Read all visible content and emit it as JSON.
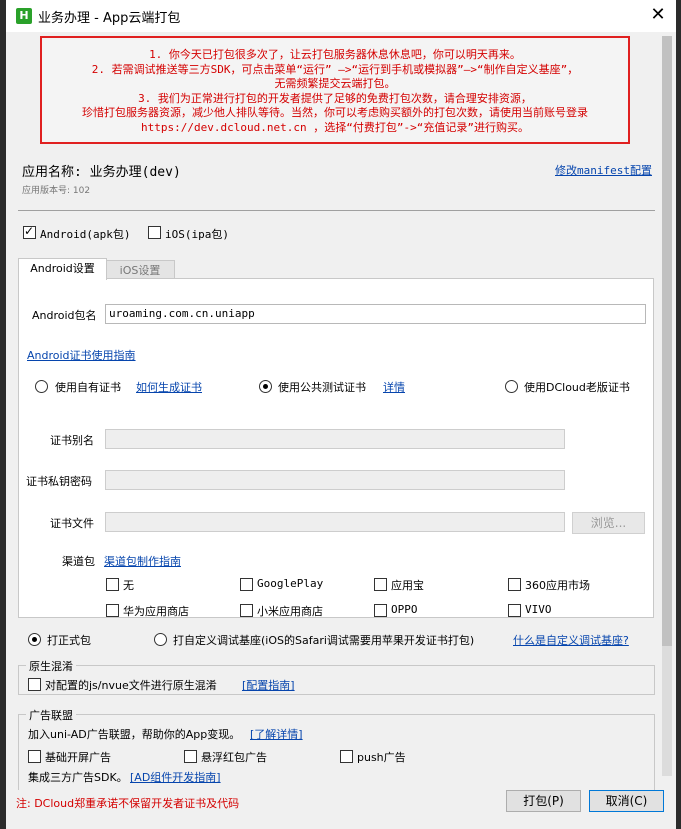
{
  "window": {
    "title": "业务办理 - App云端打包",
    "icon_letter": "H"
  },
  "notice": {
    "lines": [
      "1. 你今天已打包很多次了，让云打包服务器休息休息吧，你可以明天再来。",
      "2. 若需调试推送等三方SDK，可点击菜单“运行” —>“运行到手机或模拟器”—>“制作自定义基座”，",
      "无需频繁提交云端打包。",
      "3. 我们为正常进行打包的开发者提供了足够的免费打包次数，请合理安排资源，",
      "珍惜打包服务器资源，减少他人排队等待。当然，你可以考虑购买额外的打包次数，请使用当前账号登录",
      "https://dev.dcloud.net.cn ，选择“付费打包”->“充值记录”进行购买。"
    ]
  },
  "app": {
    "name_label": "应用名称: 业务办理(dev)",
    "version_label": "应用版本号: 102",
    "manifest_link": "修改manifest配置"
  },
  "platforms": {
    "android_label": "Android(apk包)",
    "ios_label": "iOS(ipa包)"
  },
  "tabs": {
    "android": "Android设置",
    "ios": "iOS设置"
  },
  "android": {
    "package_label": "Android包名",
    "package_value": "uroaming.com.cn.uniapp",
    "cert_guide_link": "Android证书使用指南",
    "cert_own_label": "使用自有证书",
    "cert_own_link": "如何生成证书",
    "cert_public_label": "使用公共测试证书",
    "cert_public_link": "详情",
    "cert_old_label": "使用DCloud老版证书",
    "alias_label": "证书别名",
    "password_label": "证书私钥密码",
    "file_label": "证书文件",
    "browse_label": "浏览...",
    "channel_label": "渠道包",
    "channel_link": "渠道包制作指南",
    "channels": [
      "无",
      "GooglePlay",
      "应用宝",
      "360应用市场",
      "华为应用商店",
      "小米应用商店",
      "OPPO",
      "VIVO"
    ]
  },
  "build": {
    "formal_label": "打正式包",
    "custom_label": "打自定义调试基座(iOS的Safari调试需要用苹果开发证书打包)",
    "custom_link": "什么是自定义调试基座?"
  },
  "obfuscation": {
    "title": "原生混淆",
    "option_label": "对配置的js/nvue文件进行原生混淆",
    "guide_link": "[配置指南]"
  },
  "ads": {
    "title": "广告联盟",
    "desc": "加入uni-AD广告联盟，帮助你的App变现。",
    "learn_link": "[了解详情]",
    "options": [
      "基础开屏广告",
      "悬浮红包广告",
      "push广告"
    ],
    "sdk_text": "集成三方广告SDK。",
    "sdk_link": "[AD组件开发指南]"
  },
  "footer": {
    "note": "注: DCloud郑重承诺不保留开发者证书及代码",
    "pack_button": "打包(P)",
    "cancel_button": "取消(C)"
  },
  "colors": {
    "notice_border": "#e02020",
    "notice_text": "#d40000",
    "link": "#0645ad",
    "app_icon": "#2aa12a"
  }
}
